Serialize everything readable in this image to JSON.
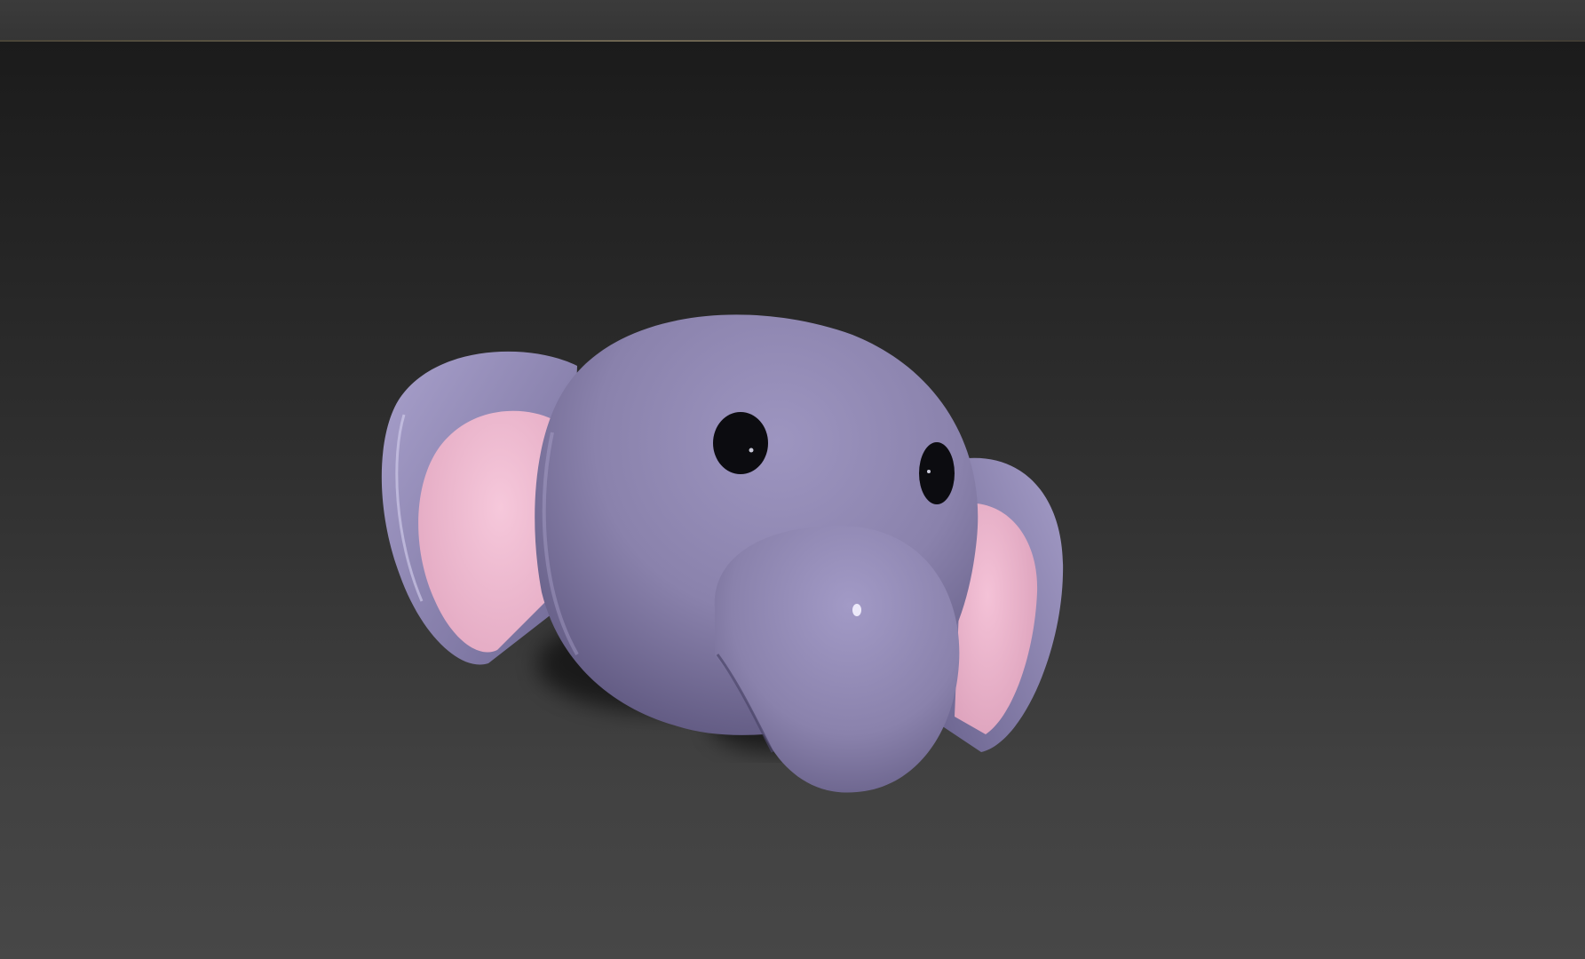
{
  "viewport": {
    "model": "elephant-head",
    "colors": {
      "body": "#8a82ac",
      "body_shadow": "#5f5880",
      "body_highlight": "#a39bc4",
      "ear_inner": "#f2bcd3",
      "eye": "#0c0c10",
      "background_top": "#1b1b1b",
      "background_bottom": "#474747"
    }
  }
}
